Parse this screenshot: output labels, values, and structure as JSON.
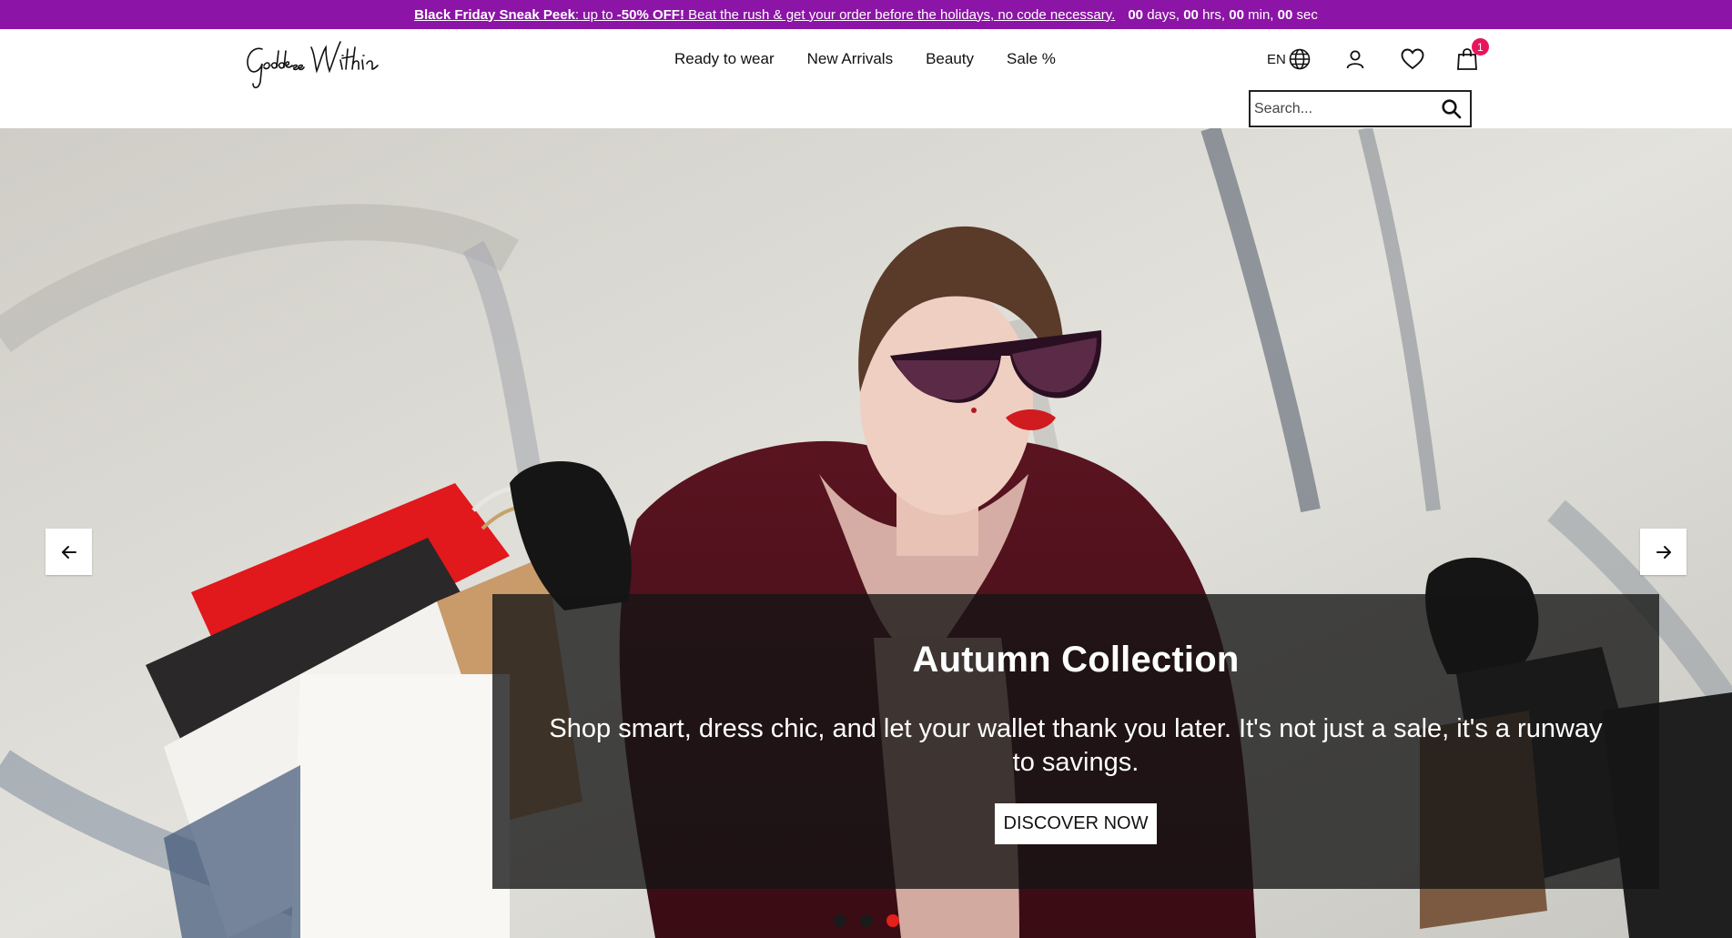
{
  "promo": {
    "headline": "Black Friday Sneak Peek",
    "message_a": ": up to ",
    "discount": "-50% OFF!",
    "message_b": " Beat the rush & get your order before the holidays, no code necessary.",
    "days": "00",
    "days_label": "days,",
    "hrs": "00",
    "hrs_label": "hrs,",
    "min": "00",
    "min_label": "min,",
    "sec": "00",
    "sec_label": "sec",
    "bar_color": "#8c14a6"
  },
  "header": {
    "logo_alt": "Goddess Within",
    "nav": [
      "Ready to wear",
      "New Arrivals",
      "Beauty",
      "Sale %"
    ],
    "language": "EN",
    "cart_count": "1",
    "search_placeholder": "Search..."
  },
  "hero": {
    "title": "Autumn Collection",
    "subtitle": "Shop smart, dress chic, and let your wallet thank you later. It's not just a sale, it's a runway to savings.",
    "cta": "DISCOVER NOW",
    "slides_total": 3,
    "active_slide": 3,
    "active_dot_color": "#e4201c"
  },
  "icons": {
    "globe": "globe-icon",
    "account": "user-icon",
    "wishlist": "heart-icon",
    "cart": "shopping-bag-icon",
    "search": "search-icon",
    "prev": "arrow-left-icon",
    "next": "arrow-right-icon"
  }
}
